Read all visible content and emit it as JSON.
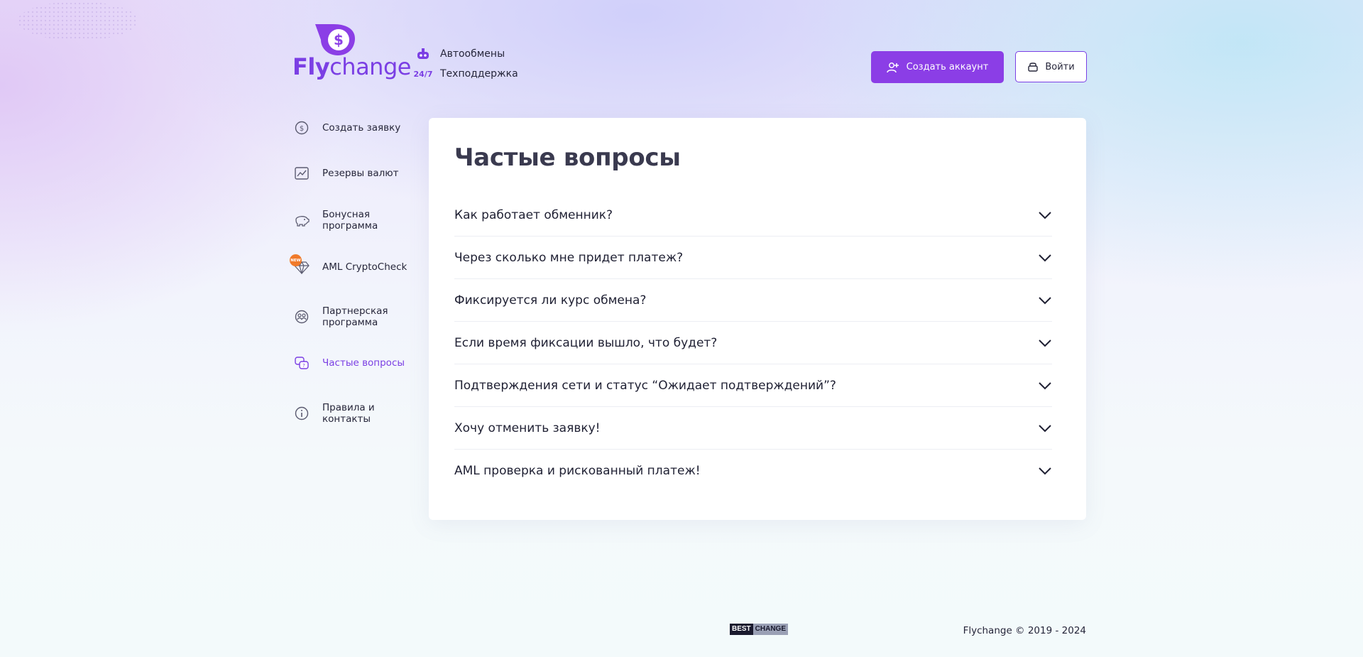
{
  "brand": {
    "fly": "Fly",
    "change": "change",
    "accent": "#7b3fe4"
  },
  "header": {
    "links": [
      {
        "icon": "robot-icon",
        "label": "Автообмены"
      },
      {
        "icon": "support-24-7-icon",
        "icon_text": "24/7",
        "label": "Техподдержка"
      }
    ],
    "create_account_label": "Создать аккаунт",
    "login_label": "Войти"
  },
  "sidebar": {
    "items": [
      {
        "icon": "dollar-exchange-icon",
        "label": "Создать заявку",
        "active": false
      },
      {
        "icon": "chart-icon",
        "label": "Резервы валют",
        "active": false
      },
      {
        "icon": "piggy-bank-icon",
        "label": "Бонусная программа",
        "active": false
      },
      {
        "icon": "diamond-icon",
        "label": "AML CryptoCheck",
        "badge": "NEW",
        "active": false
      },
      {
        "icon": "partner-icon",
        "label": "Партнерская программа",
        "active": false
      },
      {
        "icon": "faq-icon",
        "label": "Частые вопросы",
        "active": true
      },
      {
        "icon": "info-icon",
        "label": "Правила и контакты",
        "active": false
      }
    ]
  },
  "main": {
    "title": "Частые вопросы",
    "faq": [
      "Как работает обменник?",
      "Через сколько мне придет платеж?",
      "Фиксируется ли курс обмена?",
      "Если время фиксации вышло, что будет?",
      "Подтверждения сети и статус “Ожидает подтверждений”?",
      "Хочу отменить заявку!",
      "AML проверка и рискованный платеж!"
    ]
  },
  "footer": {
    "bestchange_left": "BEST",
    "bestchange_right": "CHANGE",
    "copyright": "Flychange © 2019 - 2024"
  }
}
